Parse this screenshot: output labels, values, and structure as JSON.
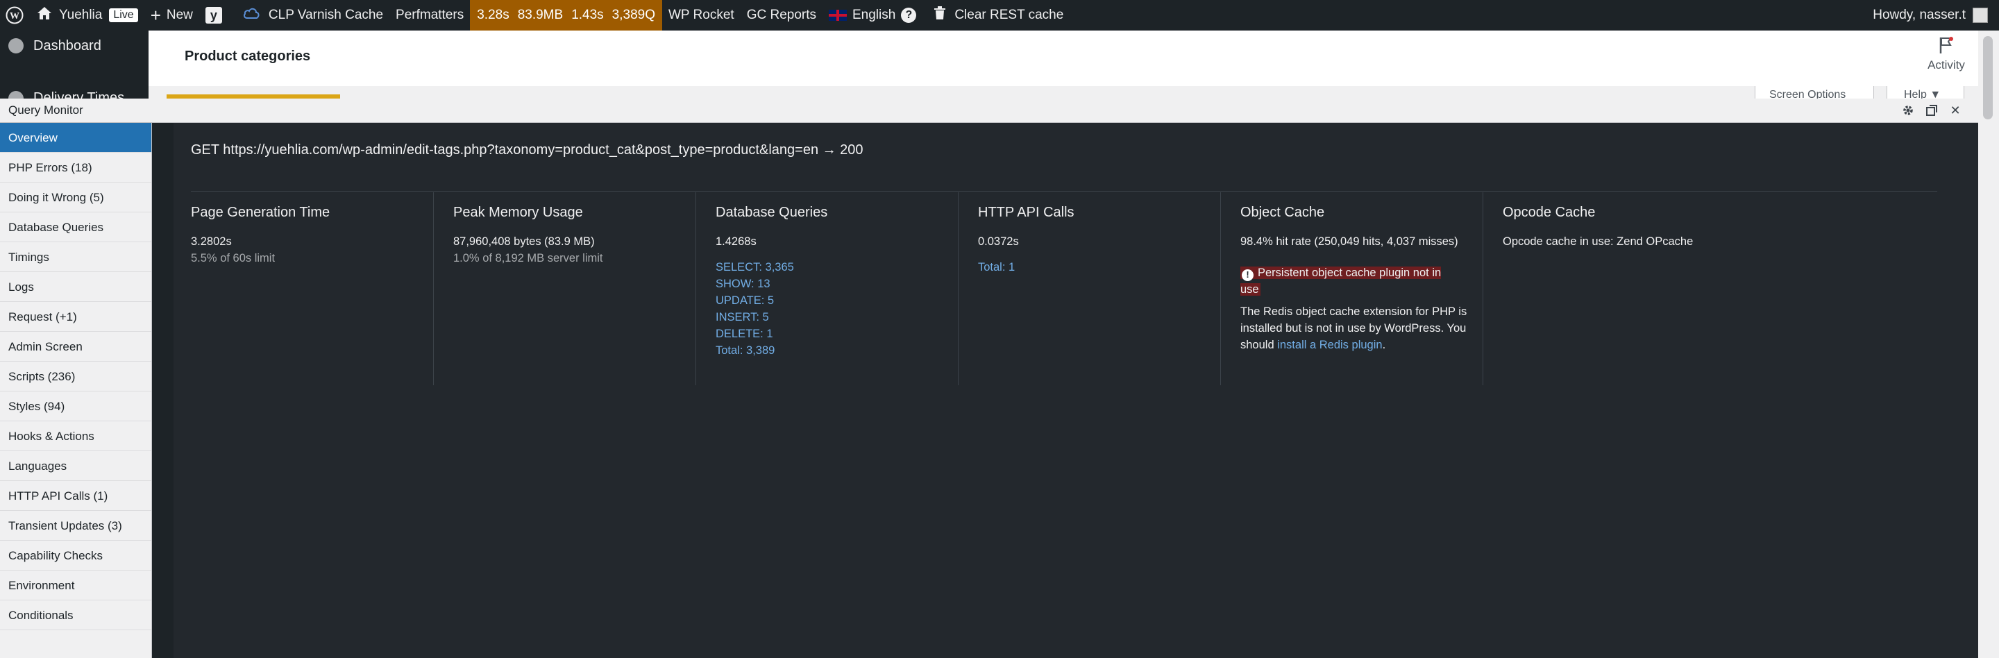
{
  "adminbar": {
    "site_name": "Yuehlia",
    "live_badge": "Live",
    "new_label": "New",
    "clp_varnish": "CLP Varnish Cache",
    "perfmatters": "Perfmatters",
    "qm_time": "3.28s",
    "qm_memory": "83.9MB",
    "qm_db_time": "1.43s",
    "qm_queries": "3,389Q",
    "wp_rocket": "WP Rocket",
    "gc_reports": "GC Reports",
    "language": "English",
    "clear_rest_cache": "Clear REST cache",
    "howdy": "Howdy, nasser.t"
  },
  "wp_menu": {
    "dashboard": "Dashboard",
    "delivery_times": "Delivery Times"
  },
  "page": {
    "heading": "Product categories",
    "activity": "Activity",
    "screen_options": "Screen Options ▼",
    "help": "Help ▼"
  },
  "qm": {
    "title": "Query Monitor",
    "nav": [
      {
        "label": "Overview",
        "active": true
      },
      {
        "label": "PHP Errors (18)"
      },
      {
        "label": "Doing it Wrong (5)"
      },
      {
        "label": "Database Queries"
      },
      {
        "label": "Timings"
      },
      {
        "label": "Logs"
      },
      {
        "label": "Request (+1)"
      },
      {
        "label": "Admin Screen"
      },
      {
        "label": "Scripts (236)"
      },
      {
        "label": "Styles (94)"
      },
      {
        "label": "Hooks & Actions"
      },
      {
        "label": "Languages"
      },
      {
        "label": "HTTP API Calls (1)"
      },
      {
        "label": "Transient Updates (3)"
      },
      {
        "label": "Capability Checks"
      },
      {
        "label": "Environment"
      },
      {
        "label": "Conditionals"
      }
    ],
    "request_line": "GET https://yuehlia.com/wp-admin/edit-tags.php?taxonomy=product_cat&post_type=product&lang=en → 200",
    "page_generation": {
      "title": "Page Generation Time",
      "value": "3.2802s",
      "limit": "5.5% of 60s limit"
    },
    "peak_memory": {
      "title": "Peak Memory Usage",
      "value": "87,960,408 bytes (83.9 MB)",
      "limit": "1.0% of 8,192 MB server limit"
    },
    "database_queries": {
      "title": "Database Queries",
      "value": "1.4268s",
      "select": "SELECT: 3,365",
      "show": "SHOW: 13",
      "update": "UPDATE: 5",
      "insert": "INSERT: 5",
      "delete": "DELETE: 1",
      "total": "Total: 3,389"
    },
    "http_api_calls": {
      "title": "HTTP API Calls",
      "value": "0.0372s",
      "total": "Total: 1"
    },
    "object_cache": {
      "title": "Object Cache",
      "hit_rate": "98.4% hit rate (250,049 hits, 4,037 misses)",
      "warning": "Persistent object cache plugin not in use",
      "note": "The Redis object cache extension for PHP is installed but is not in use by WordPress. You should",
      "link": "install a Redis plugin",
      "note_end": "."
    },
    "opcode_cache": {
      "title": "Opcode Cache",
      "value": "Opcode cache in use: Zend OPcache"
    }
  }
}
